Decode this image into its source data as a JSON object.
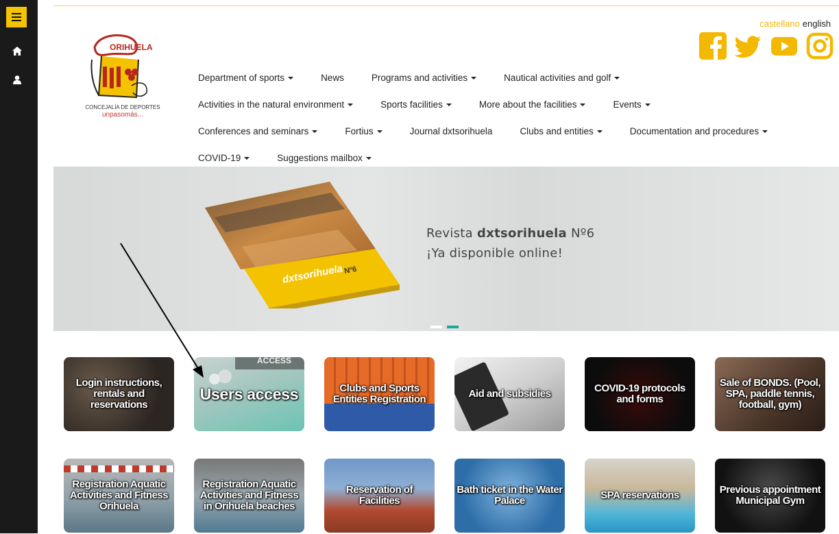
{
  "sidebar": {
    "items": [
      "menu-icon",
      "home-icon",
      "user-icon"
    ]
  },
  "header": {
    "logo": {
      "title": "ORIHUELA",
      "line1": "CONCEJALÍA DE DEPORTES",
      "line2": "unpasomás..."
    },
    "lang": {
      "es": "castellano",
      "en": "english"
    },
    "social": [
      "facebook-icon",
      "twitter-icon",
      "youtube-icon",
      "instagram-icon"
    ]
  },
  "nav": {
    "row1": [
      "Department of sports",
      "News",
      "Programs and activities",
      "Nautical activities and golf"
    ],
    "row2": [
      "Activities in the natural environment",
      "Sports facilities",
      "More about the facilities",
      "Events"
    ],
    "row3": [
      "Conferences and seminars",
      "Fortius",
      "Journal dxtsorihuela",
      "Clubs and entities",
      "Documentation and procedures"
    ],
    "row4": [
      "COVID-19",
      "Suggestions mailbox"
    ]
  },
  "banner": {
    "line1_pre": "Revista ",
    "line1_bold": "dxtsorihuela",
    "line1_post": " Nº6",
    "line2": "¡Ya disponible online!",
    "mag_title": "dxtsorihuela",
    "mag_no": "Nº6"
  },
  "tiles": {
    "row1": [
      "Login instructions, rentals and reservations",
      "Users access",
      "Clubs and Sports Entities Registration",
      "Aid and subsidies",
      "COVID-19 protocols and forms",
      "Sale of BONDS. (Pool, SPA, paddle tennis, football, gym)"
    ],
    "row2": [
      "Registration Aquatic Activities and Fitness Orihuela",
      "Registration Aquatic Activities and Fitness in Orihuela beaches",
      "Reservation of Facilities",
      "Bath ticket in the Water Palace",
      "SPA reservations",
      "Previous appointment Municipal Gym"
    ],
    "access_sign": "ACCESS"
  }
}
